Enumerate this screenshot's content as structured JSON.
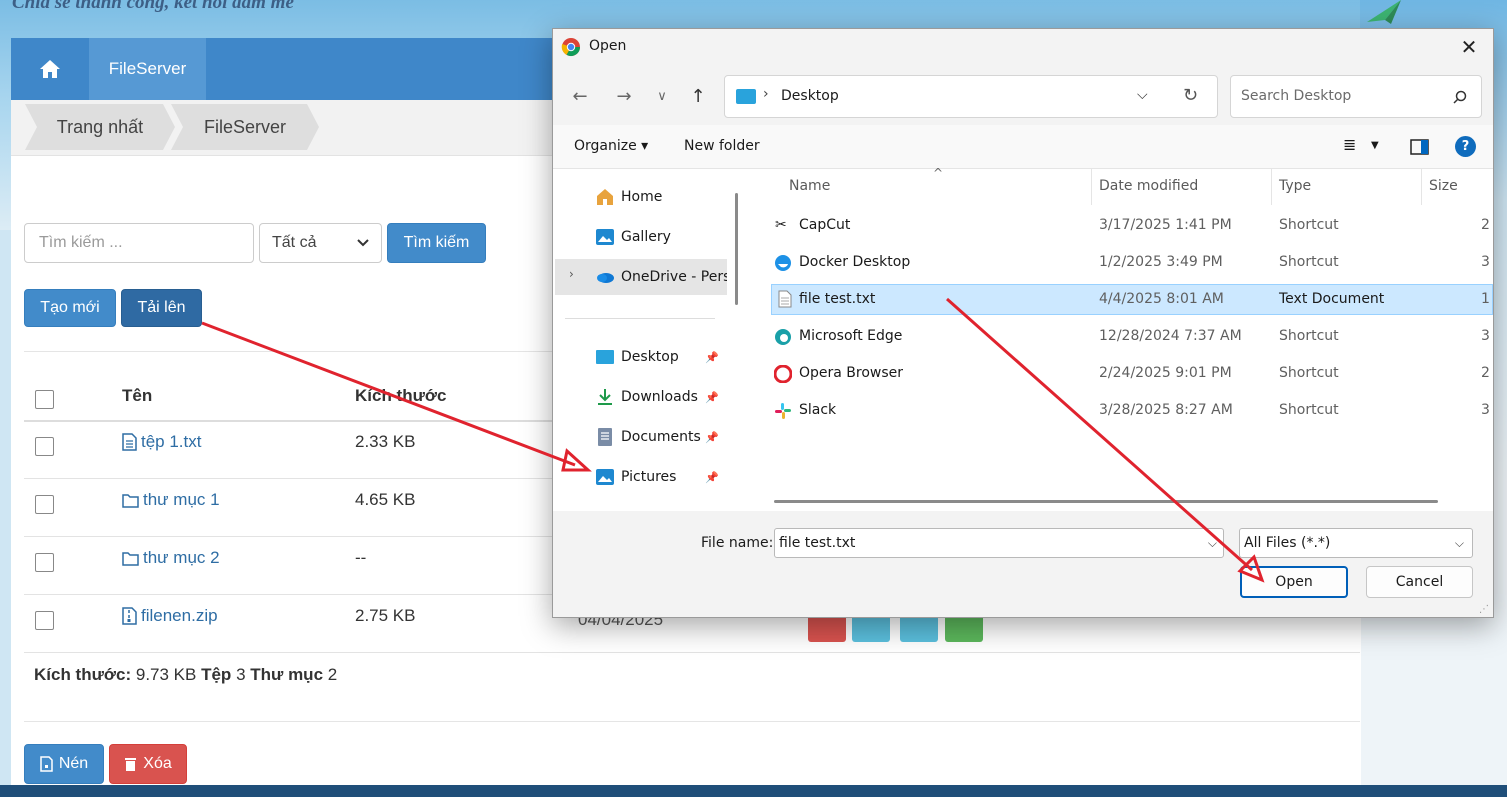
{
  "site": {
    "tagline": "Chia sẻ thành công, kết nối đam mê"
  },
  "nav": {
    "fileserver_label": "FileServer"
  },
  "breadcrumb": [
    "Trang nhất",
    "FileServer"
  ],
  "search": {
    "placeholder": "Tìm kiếm ...",
    "filter_value": "Tất cả",
    "search_label": "Tìm kiếm"
  },
  "actions": {
    "create_label": "Tạo mới",
    "upload_label": "Tải lên"
  },
  "table": {
    "columns": [
      "Tên",
      "Kích thước"
    ],
    "rows": [
      {
        "name": "tệp 1.txt",
        "size": "2.33 KB",
        "kind": "file"
      },
      {
        "name": "thư mục 1",
        "size": "4.65 KB",
        "kind": "folder"
      },
      {
        "name": "thư mục 2",
        "size": "--",
        "kind": "folder"
      },
      {
        "name": "filenen.zip",
        "size": "2.75 KB",
        "kind": "zip",
        "date": "04/04/2025"
      }
    ]
  },
  "summary": {
    "size_label": "Kích thước:",
    "size_value": "9.73 KB",
    "files_label": "Tệp",
    "files_value": "3",
    "folders_label": "Thư mục",
    "folders_value": "2"
  },
  "bottom_actions": {
    "compress_label": "Nén",
    "delete_label": "Xóa"
  },
  "colors": {
    "primary": "#428bca",
    "danger": "#d9534f",
    "info": "#5bc0de",
    "success": "#5cb85c",
    "annotation": "#e0232e"
  },
  "dialog": {
    "title": "Open",
    "address": "Desktop",
    "search_placeholder": "Search Desktop",
    "toolbar": {
      "organize": "Organize",
      "new_folder": "New folder"
    },
    "nav_items": [
      {
        "label": "Home",
        "icon": "home-icon"
      },
      {
        "label": "Gallery",
        "icon": "gallery-icon"
      },
      {
        "label": "OneDrive - Perso",
        "icon": "onedrive-icon"
      },
      {
        "label": "Desktop",
        "icon": "desktop-icon"
      },
      {
        "label": "Downloads",
        "icon": "download-icon"
      },
      {
        "label": "Documents",
        "icon": "documents-icon"
      },
      {
        "label": "Pictures",
        "icon": "pictures-icon"
      }
    ],
    "columns": [
      "Name",
      "Date modified",
      "Type",
      "Size"
    ],
    "files": [
      {
        "name": "CapCut",
        "date": "3/17/2025 1:41 PM",
        "type": "Shortcut",
        "size": "2"
      },
      {
        "name": "Docker Desktop",
        "date": "1/2/2025 3:49 PM",
        "type": "Shortcut",
        "size": "3"
      },
      {
        "name": "file test.txt",
        "date": "4/4/2025 8:01 AM",
        "type": "Text Document",
        "size": "1"
      },
      {
        "name": "Microsoft Edge",
        "date": "12/28/2024 7:37 AM",
        "type": "Shortcut",
        "size": "3"
      },
      {
        "name": "Opera Browser",
        "date": "2/24/2025 9:01 PM",
        "type": "Shortcut",
        "size": "2"
      },
      {
        "name": "Slack",
        "date": "3/28/2025 8:27 AM",
        "type": "Shortcut",
        "size": "3"
      }
    ],
    "file_name_label": "File name:",
    "file_name_value": "file test.txt",
    "file_type_value": "All Files (*.*)",
    "open_label": "Open",
    "cancel_label": "Cancel"
  }
}
